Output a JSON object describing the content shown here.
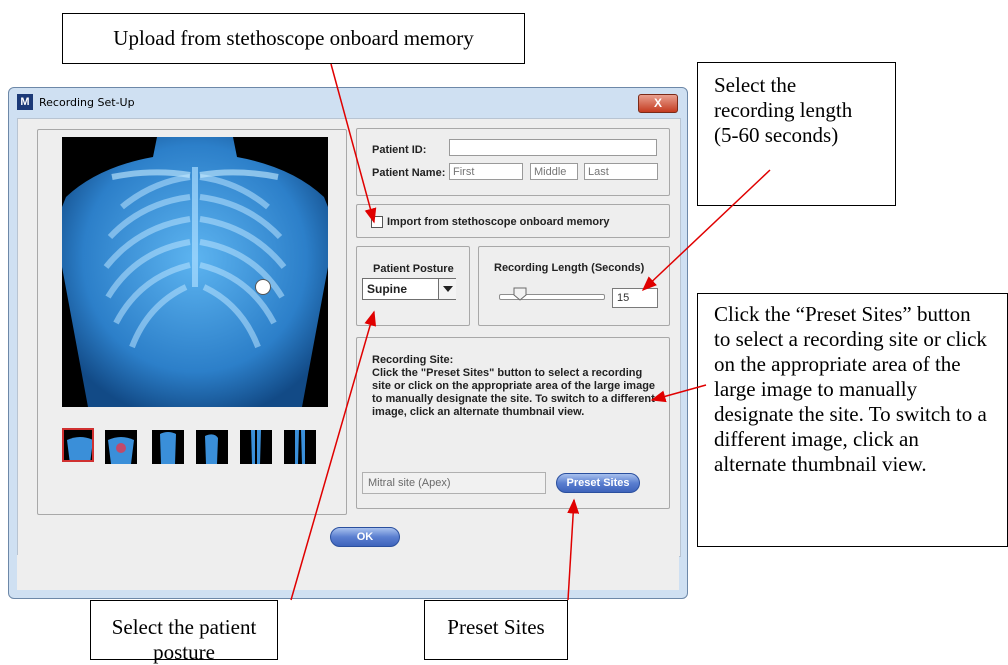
{
  "window": {
    "title": "Recording Set-Up",
    "close_label": "X"
  },
  "patient": {
    "id_label": "Patient ID:",
    "id_value": "",
    "name_label": "Patient Name:",
    "first_placeholder": "First",
    "middle_placeholder": "Middle",
    "last_placeholder": "Last"
  },
  "import": {
    "label": "Import from stethoscope onboard memory",
    "checked": false
  },
  "posture": {
    "label": "Patient Posture",
    "selected": "Supine"
  },
  "length": {
    "label": "Recording Length (Seconds)",
    "value": "15",
    "min": 5,
    "max": 60
  },
  "site": {
    "heading": "Recording Site:",
    "instructions": "Click the \"Preset Sites\" button to select a recording site or click on the appropriate area of the large image to manually designate the site. To switch to a different image, click an alternate thumbnail view.",
    "current": "Mitral site (Apex)",
    "preset_button": "Preset Sites"
  },
  "thumbnails": [
    "chest-front",
    "chest-back",
    "torso-front",
    "torso-side",
    "legs-front",
    "legs-back"
  ],
  "ok_button": "OK",
  "callouts": {
    "upload": "Upload from stethoscope onboard memory",
    "length": "Select the recording length (5-60 seconds)",
    "preset_desc": "Click the “Preset Sites” button to select a recording site or click on the appropriate area of the large image to manually designate the site.  To switch to a different image, click an alternate thumbnail view.",
    "posture": "Select the patient posture",
    "preset": "Preset Sites"
  },
  "colors": {
    "window_frame": "#cfe0f2",
    "panel_bg": "#eeeeee",
    "button_blue": "#4a6fc6",
    "arrow": "#e00000",
    "chest_blue": "#3a8fd9"
  }
}
